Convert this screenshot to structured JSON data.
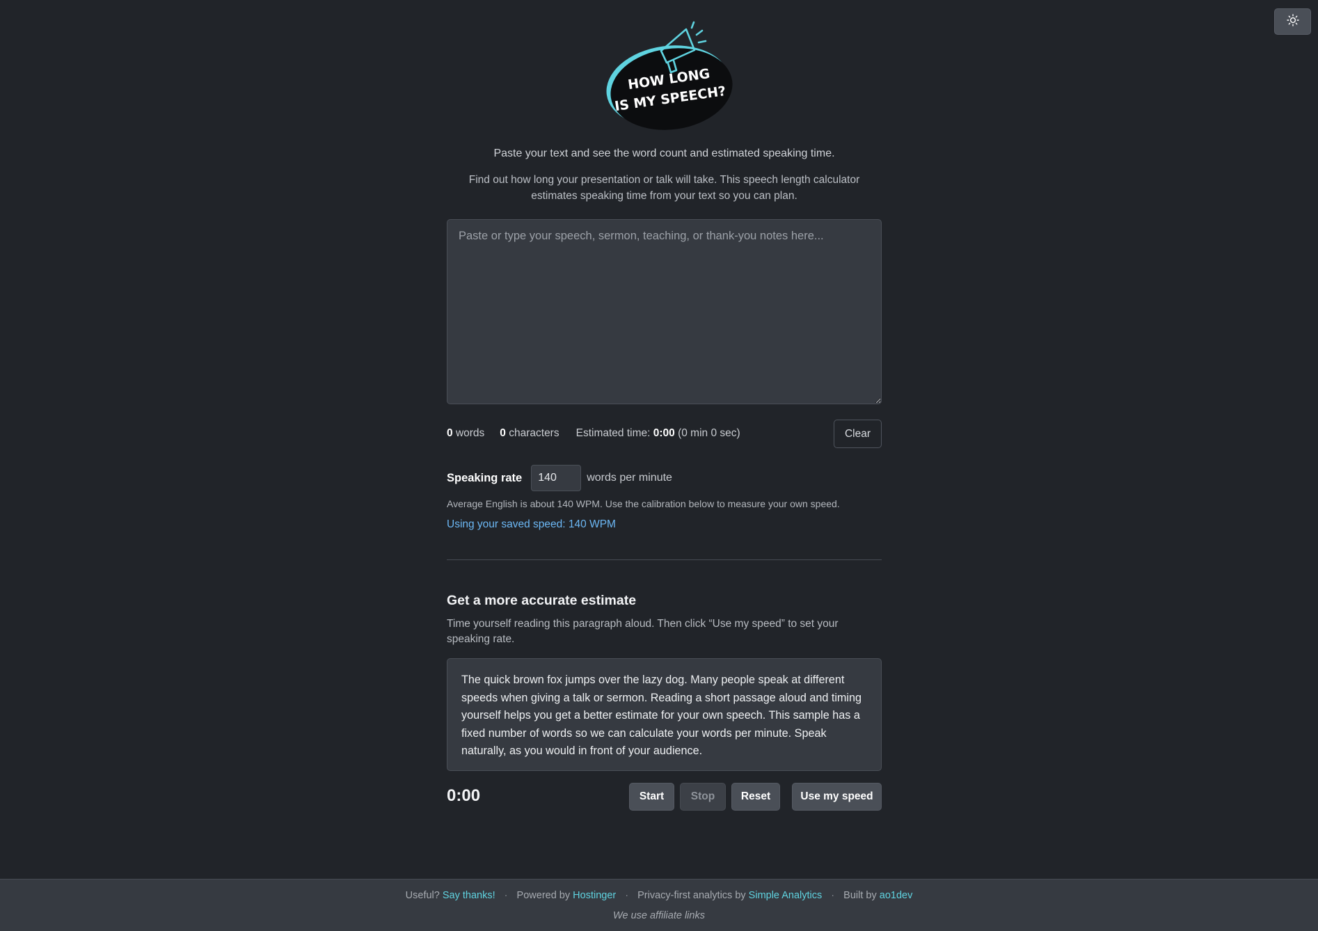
{
  "theme_toggle": {
    "icon": "sun-icon"
  },
  "logo": {
    "line1": "HOW LONG",
    "line2": "IS MY SPEECH?",
    "icon": "megaphone-icon"
  },
  "tagline": "Paste your text and see the word count and estimated speaking time.",
  "intro": "Find out how long your presentation or talk will take. This speech length calculator estimates speaking time from your text so you can plan.",
  "speech_input": {
    "value": "",
    "placeholder": "Paste or type your speech, sermon, teaching, or thank-you notes here..."
  },
  "stats": {
    "words_count": "0",
    "words_label": "words",
    "chars_count": "0",
    "chars_label": "characters",
    "time_label": "Estimated time:",
    "time_value": "0:00",
    "time_detail": "(0 min 0 sec)"
  },
  "clear_label": "Clear",
  "rate": {
    "label": "Speaking rate",
    "value": "140",
    "unit": "words per minute",
    "help": "Average English is about 140 WPM. Use the calibration below to measure your own speed.",
    "saved_link": "Using your saved speed: 140 WPM"
  },
  "calibration": {
    "title": "Get a more accurate estimate",
    "description": "Time yourself reading this paragraph aloud. Then click “Use my speed” to set your speaking rate.",
    "sample": "The quick brown fox jumps over the lazy dog. Many people speak at different speeds when giving a talk or sermon. Reading a short passage aloud and timing yourself helps you get a better estimate for your own speech. This sample has a fixed number of words so we can calculate your words per minute. Speak naturally, as you would in front of your audience.",
    "timer": "0:00",
    "start": "Start",
    "stop": "Stop",
    "reset": "Reset",
    "use_speed": "Use my speed"
  },
  "footer": {
    "useful": "Useful?",
    "say_thanks": "Say thanks!",
    "powered_by": "Powered by",
    "hostinger": "Hostinger",
    "analytics": "Privacy-first analytics by",
    "simple_analytics": "Simple Analytics",
    "built_by": "Built by",
    "author": "ao1dev",
    "separator": "·",
    "affiliate": "We use affiliate links"
  },
  "colors": {
    "background": "#212429",
    "panel": "#363a41",
    "link": "#6cb8f5",
    "footer_link": "#5fd3e0",
    "accent": "#5fd3e0"
  }
}
